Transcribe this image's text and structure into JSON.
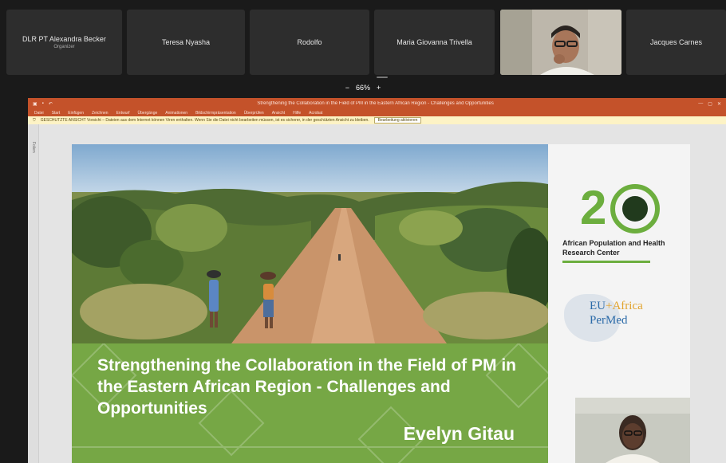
{
  "participants": [
    {
      "name": "DLR PT Alexandra Becker",
      "role": "Organizer"
    },
    {
      "name": "Teresa Nyasha"
    },
    {
      "name": "Rodolfo"
    },
    {
      "name": "Maria Giovanna Trivella"
    },
    {
      "name": "",
      "video": true
    },
    {
      "name": "Jacques Carnes"
    }
  ],
  "zoom": {
    "minus": "−",
    "level": "66%",
    "plus": "+"
  },
  "window": {
    "title": "Strengthening the Collaboration in the Field of PM in the Eastern African Region - Challenges and Opportunities",
    "ribbon_tabs": [
      "Datei",
      "Start",
      "Einfügen",
      "Zeichnen",
      "Entwurf",
      "Übergänge",
      "Animationen",
      "Bildschirmpräsentation",
      "Überprüfen",
      "Ansicht",
      "Hilfe",
      "Acrobat"
    ],
    "infobar_text": "GESCHÜTZTE ANSICHT  Vorsicht – Dateien aus dem Internet können Viren enthalten. Wenn Sie die Datei nicht bearbeiten müssen, ist es sicherer, in der geschützten Ansicht zu bleiben.",
    "infobar_button": "Bearbeitung aktivieren",
    "thumb_label": "Folien"
  },
  "slide": {
    "title": "Strengthening the Collaboration in the Field of PM in the Eastern African Region - Challenges and Opportunities",
    "presenter": "Evelyn Gitau",
    "aphrc": {
      "anniversary": "2",
      "name": "African Population and Health Research Center"
    },
    "eu": {
      "eu": "EU",
      "plus": "+",
      "africa": "Africa",
      "permed": "PerMed"
    }
  },
  "colors": {
    "ppt_orange": "#c4522a",
    "banner_green": "#76a745",
    "logo_green": "#6cae3e"
  }
}
